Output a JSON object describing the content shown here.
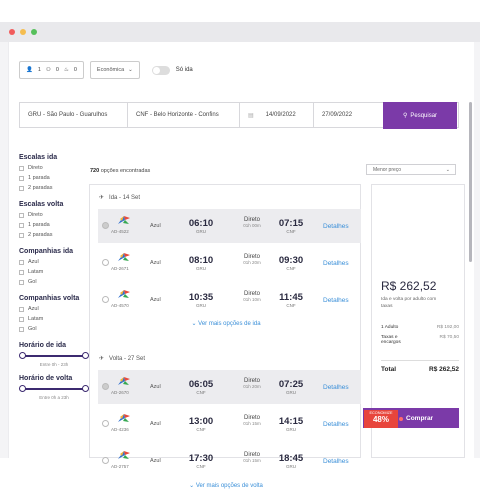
{
  "window": {
    "dots": [
      "#f15c5c",
      "#f5bd4f",
      "#56c05b"
    ]
  },
  "search": {
    "pax": {
      "adults": "1",
      "children": "0",
      "infants": "0"
    },
    "cabin": "Econômica",
    "one_way_label": "Só ida",
    "origin": "GRU - São Paulo - Guarulhos",
    "destination": "CNF - Belo Horizonte - Confins",
    "depart_date": "14/09/2022",
    "return_date": "27/09/2022",
    "search_button": "Pesquisar"
  },
  "filters": {
    "stops_outbound": {
      "title": "Escalas ida",
      "options": [
        "Direto",
        "1 parada",
        "2 paradas"
      ]
    },
    "stops_return": {
      "title": "Escalas volta",
      "options": [
        "Direto",
        "1 parada",
        "2 paradas"
      ]
    },
    "airlines_outbound": {
      "title": "Companhias ida",
      "options": [
        "Azul",
        "Latam",
        "Gol"
      ]
    },
    "airlines_return": {
      "title": "Companhias volta",
      "options": [
        "Azul",
        "Latam",
        "Gol"
      ]
    },
    "time_outbound": {
      "title": "Horário de ida",
      "caption": "Entre 0h - 23h"
    },
    "time_return": {
      "title": "Horário de volta",
      "caption": "Entre 0h a 23h"
    }
  },
  "results": {
    "count": "720",
    "count_suffix": "opções encontradas",
    "sort": "Menor preço",
    "outbound": {
      "label": "Ida - 14 Set",
      "more": "Ver mais opções de ida",
      "flights": [
        {
          "code": "AD-4522",
          "airline": "Azul",
          "dep": "06:10",
          "from": "GRU",
          "stop": "Direto",
          "dur": "01h 00m",
          "arr": "07:15",
          "to": "CNF",
          "details": "Detalhes"
        },
        {
          "code": "AD-2671",
          "airline": "Azul",
          "dep": "08:10",
          "from": "GRU",
          "stop": "Direto",
          "dur": "01h 20m",
          "arr": "09:30",
          "to": "CNF",
          "details": "Detalhes"
        },
        {
          "code": "AD-4570",
          "airline": "Azul",
          "dep": "10:35",
          "from": "GRU",
          "stop": "Direto",
          "dur": "01h 10m",
          "arr": "11:45",
          "to": "CNF",
          "details": "Detalhes"
        }
      ]
    },
    "return": {
      "label": "Volta - 27 Set",
      "more": "Ver mais opções de volta",
      "flights": [
        {
          "code": "AD-2670",
          "airline": "Azul",
          "dep": "06:05",
          "from": "CNF",
          "stop": "Direto",
          "dur": "01h 20m",
          "arr": "07:25",
          "to": "GRU",
          "details": "Detalhes"
        },
        {
          "code": "AD-4236",
          "airline": "Azul",
          "dep": "13:00",
          "from": "CNF",
          "stop": "Direto",
          "dur": "01h 15m",
          "arr": "14:15",
          "to": "GRU",
          "details": "Detalhes"
        },
        {
          "code": "AD-2757",
          "airline": "Azul",
          "dep": "17:30",
          "from": "CNF",
          "stop": "Direto",
          "dur": "01h 15m",
          "arr": "18:45",
          "to": "GRU",
          "details": "Detalhes"
        }
      ]
    }
  },
  "summary": {
    "price": "R$ 262,52",
    "note": "Ida e volta por adulto com taxas",
    "adult_label": "1 Adulto",
    "adult_value": "R$ 192,00",
    "taxes_label": "Taxas e encargos",
    "taxes_value": "R$ 70,50",
    "total_label": "Total",
    "total_value": "R$ 262,52",
    "discount_label": "ECONOMIZE",
    "discount_value": "48%",
    "buy_label": "Comprar"
  },
  "colors": {
    "accent": "#7b3aa8",
    "link": "#3a8fd8",
    "discount": "#e8453c",
    "navy": "#2a2a4a"
  }
}
